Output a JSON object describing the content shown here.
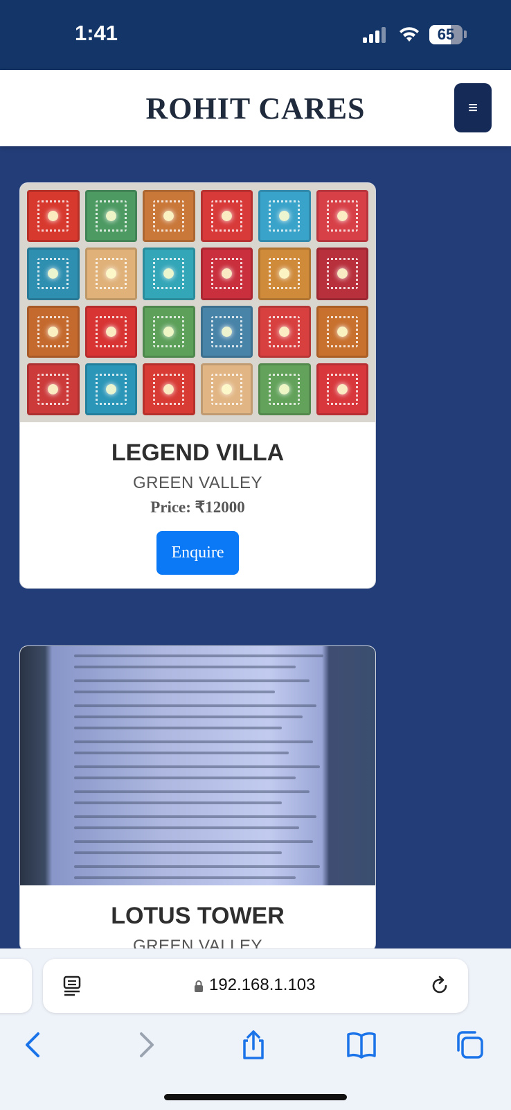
{
  "status_bar": {
    "time": "1:41",
    "battery": "65",
    "battery_level_percent": 65
  },
  "navbar": {
    "brand": "ROHIT CARES",
    "menu_icon": "≡"
  },
  "listings": [
    {
      "title": "LEGEND VILLA",
      "location": "GREEN VALLEY",
      "price": "Price: ₹12000",
      "button": "Enquire"
    },
    {
      "title": "LOTUS TOWER",
      "location": "GREEN VALLEY"
    }
  ],
  "browser": {
    "url": "192.168.1.103"
  },
  "icons": {
    "reader": "reader-icon",
    "lock": "lock-icon",
    "reload": "reload-icon",
    "back": "back-icon",
    "forward": "forward-icon",
    "share": "share-icon",
    "bookmarks": "bookmarks-icon",
    "tabs": "tabs-icon"
  },
  "colors": {
    "page_bg": "#233d78",
    "status_bg": "#143567",
    "accent": "#0b79f5",
    "menu_bg": "#152a57"
  }
}
